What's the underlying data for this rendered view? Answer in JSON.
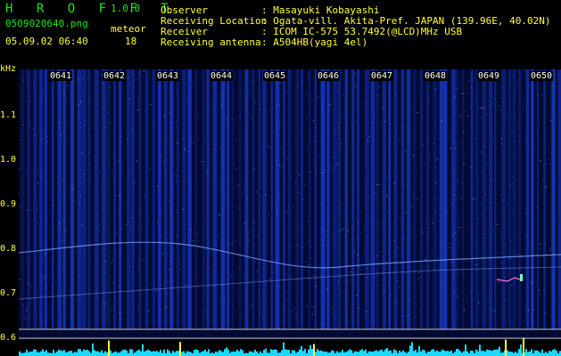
{
  "app": {
    "logo": "H R O F F T",
    "version": "1.0.0",
    "filename": "0509020640.png",
    "datetime": "05.09.02 06:40",
    "meteor_label": "meteor",
    "meteor_count": "18"
  },
  "info": {
    "labels": [
      "Observer",
      "Receiving Location",
      "Receiver",
      "Receiving antenna"
    ],
    "values": [
      ": Masayuki Kobayashi",
      ": Ogata-vill. Akita-Pref. JAPAN (139.96E, 40.02N)",
      ": ICOM IC-575 53.7492(@LCD)MHz USB",
      ": A504HB(yagi 4el)"
    ]
  },
  "axis": {
    "unit": "kHz",
    "y_ticks": [
      "1.1",
      "1.0",
      "0.9",
      "0.8",
      "0.7",
      "0.6"
    ],
    "time_ticks": [
      "0641",
      "0642",
      "0643",
      "0644",
      "0645",
      "0646",
      "0647",
      "0648",
      "0649",
      "0650"
    ]
  },
  "colors": {
    "background": "#000000",
    "spectrum_base": "#000a33",
    "noise": "#1a3fd9",
    "trail": "#7fa6ff",
    "level_meter": "#1ad9ff",
    "header_green": "#19e619",
    "header_yellow": "#ffff33"
  }
}
